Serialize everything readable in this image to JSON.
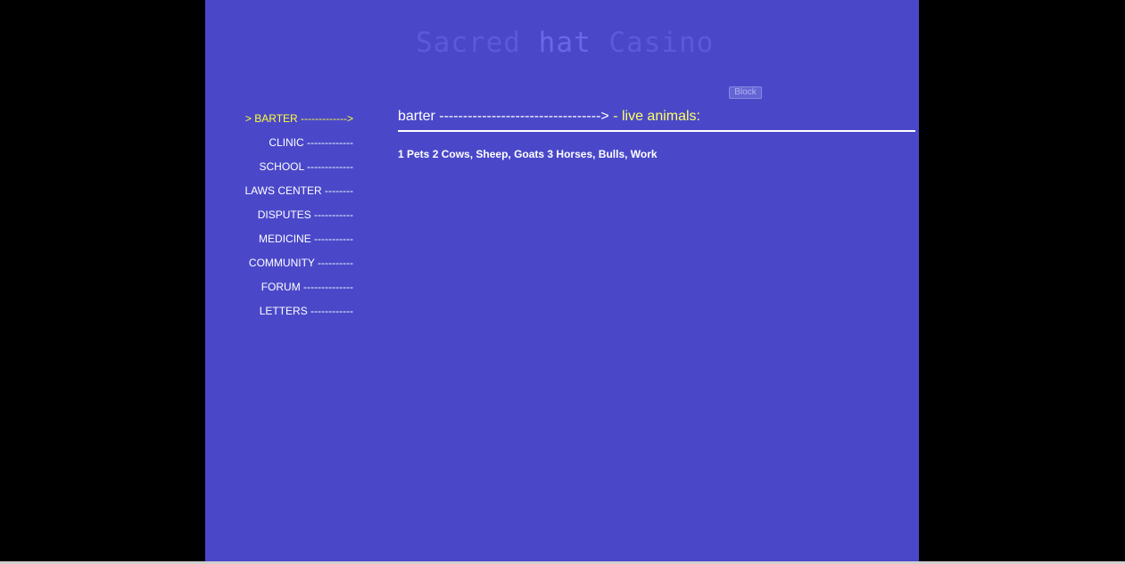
{
  "header": {
    "title_part1": "Sacred ",
    "title_part2": "hat",
    "title_part3": " Casino",
    "block_label": "Block"
  },
  "sidebar": {
    "items": [
      {
        "label": "> BARTER ------------->",
        "active": true
      },
      {
        "label": "CLINIC -------------"
      },
      {
        "label": "SCHOOL -------------"
      },
      {
        "label": "LAWS CENTER --------"
      },
      {
        "label": "DISPUTES -----------"
      },
      {
        "label": "MEDICINE -----------"
      },
      {
        "label": "COMMUNITY ----------"
      },
      {
        "label": "FORUM --------------"
      },
      {
        "label": "LETTERS ------------"
      }
    ]
  },
  "content": {
    "heading_prefix": "barter ----------------------------------> ",
    "heading_sub": "- live animals:",
    "categories": [
      "1 Pets",
      "2 Cows, Sheep, Goats",
      "3 Horses, Bulls, Work"
    ]
  },
  "colors": {
    "background": "#000000",
    "page": "#4a48c9",
    "active_nav": "#ffff33",
    "text": "#ffffff"
  }
}
